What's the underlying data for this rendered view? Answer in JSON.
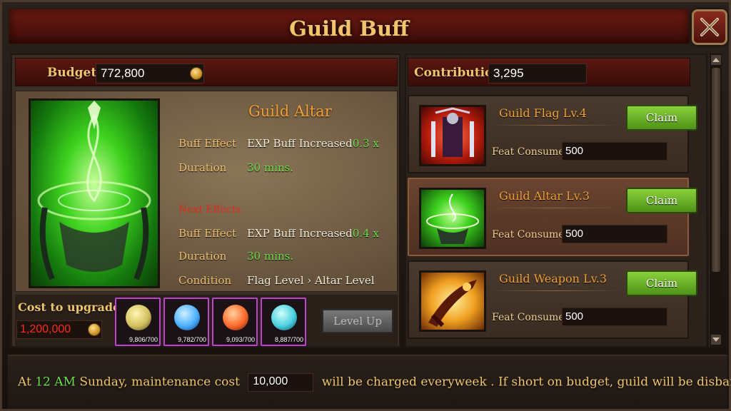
{
  "title": "Guild Buff",
  "budget": {
    "label": "Budget",
    "value": "772,800"
  },
  "contribution": {
    "label": "Contribution",
    "value": "3,295"
  },
  "altar": {
    "name": "Guild Altar",
    "current": {
      "buff_label": "Buff Effect",
      "buff_text": "EXP Buff Increased",
      "buff_amount": "0.3 x",
      "duration_label": "Duration",
      "duration_value": "30 mins."
    },
    "next_label": "Next Effects",
    "next": {
      "buff_label": "Buff Effect",
      "buff_text": "EXP Buff Increased",
      "buff_amount": "0.4 x",
      "duration_label": "Duration",
      "duration_value": "30 mins.",
      "condition_label": "Condition",
      "condition_value": "Flag Level › Altar Level"
    }
  },
  "upgrade": {
    "cost_label": "Cost to upgrade",
    "cost_value": "1,200,000",
    "materials": [
      {
        "icon": "gold-emblem-icon",
        "qty": "9,806/700",
        "color": "#d4c060"
      },
      {
        "icon": "blue-crystal-icon",
        "qty": "9,782/700",
        "color": "#4ab0ff"
      },
      {
        "icon": "fire-rune-icon",
        "qty": "9,093/700",
        "color": "#ff6a2a"
      },
      {
        "icon": "earth-orb-icon",
        "qty": "8,887/700",
        "color": "#4ad0e0"
      }
    ],
    "level_up_label": "Level Up"
  },
  "buffs": [
    {
      "name": "Guild Flag Lv.4",
      "claim_label": "Claim",
      "feat_label": "Feat Consumed:",
      "feat_value": "500",
      "icon": "guild-flag-icon"
    },
    {
      "name": "Guild Altar Lv.3",
      "claim_label": "Claim",
      "feat_label": "Feat Consumed:",
      "feat_value": "500",
      "icon": "guild-altar-icon"
    },
    {
      "name": "Guild Weapon Lv.3",
      "claim_label": "Claim",
      "feat_label": "Feat Consumed:",
      "feat_value": "500",
      "icon": "guild-weapon-icon"
    }
  ],
  "footer": {
    "prefix": "At",
    "time": "12 AM",
    "middle": "Sunday, maintenance cost",
    "maintenance_value": "10,000",
    "suffix": "will be charged everyweek . If short on budget, guild will be disbanded."
  }
}
